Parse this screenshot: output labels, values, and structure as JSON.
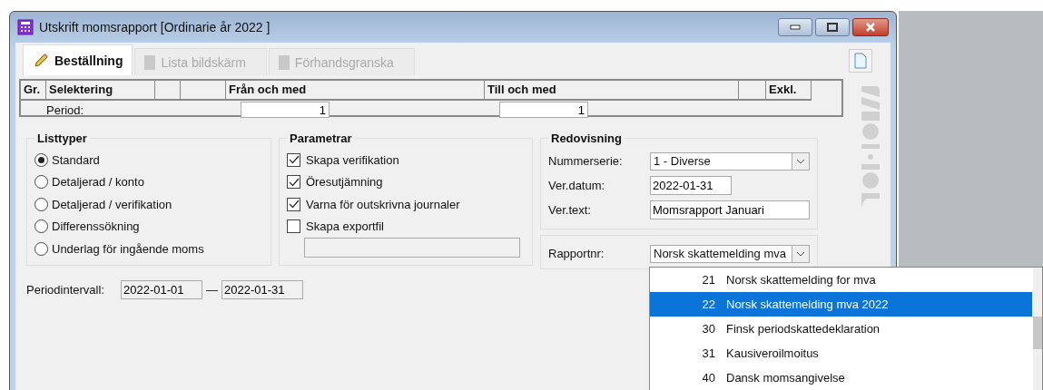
{
  "window": {
    "title": "Utskrift momsrapport [Ordinarie år 2022 ]"
  },
  "tabs": [
    {
      "label": "Beställning",
      "selected": true,
      "disabled": false
    },
    {
      "label": "Lista bildskärm",
      "selected": false,
      "disabled": true
    },
    {
      "label": "Förhandsgranska",
      "selected": false,
      "disabled": true
    }
  ],
  "selection_table": {
    "columns": [
      "Gr.",
      "Selektering",
      "",
      "",
      "Från och med",
      "Till och med",
      "",
      "Exkl."
    ],
    "rows": [
      {
        "label": "Period:",
        "from": "1",
        "to": "1"
      }
    ]
  },
  "listtyper": {
    "title": "Listtyper",
    "options": [
      {
        "label": "Standard",
        "selected": true
      },
      {
        "label": "Detaljerad / konto",
        "selected": false
      },
      {
        "label": "Detaljerad / verifikation",
        "selected": false
      },
      {
        "label": "Differenssökning",
        "selected": false
      },
      {
        "label": "Underlag för ingående moms",
        "selected": false
      }
    ]
  },
  "parametrar": {
    "title": "Parametrar",
    "options": [
      {
        "label": "Skapa verifikation",
        "checked": true
      },
      {
        "label": "Öresutjämning",
        "checked": true
      },
      {
        "label": "Varna för outskrivna journaler",
        "checked": true
      },
      {
        "label": "Skapa exportfil",
        "checked": false
      }
    ]
  },
  "redovisning": {
    "title": "Redovisning",
    "fields": [
      {
        "label": "Nummerserie:",
        "value": "1 - Diverse",
        "kind": "dropdown"
      },
      {
        "label": "Ver.datum:",
        "value": "2022-01-31",
        "kind": "short"
      },
      {
        "label": "Ver.text:",
        "value": "Momsrapport Januari",
        "kind": "text"
      }
    ]
  },
  "rapportnr": {
    "label": "Rapportnr:",
    "value": "Norsk skattemelding mva",
    "options": [
      {
        "number": "21",
        "label": "Norsk skattemelding for mva",
        "selected": false
      },
      {
        "number": "22",
        "label": "Norsk skattemelding mva 2022",
        "selected": true
      },
      {
        "number": "30",
        "label": "Finsk periodskattedeklaration",
        "selected": false
      },
      {
        "number": "31",
        "label": "Kausiveroilmoitus",
        "selected": false
      },
      {
        "number": "40",
        "label": "Dansk momsangivelse",
        "selected": false
      }
    ]
  },
  "periodintervall": {
    "label": "Periodintervall:",
    "from": "2022-01-01",
    "separator": "—",
    "to": "2022-01-31"
  }
}
